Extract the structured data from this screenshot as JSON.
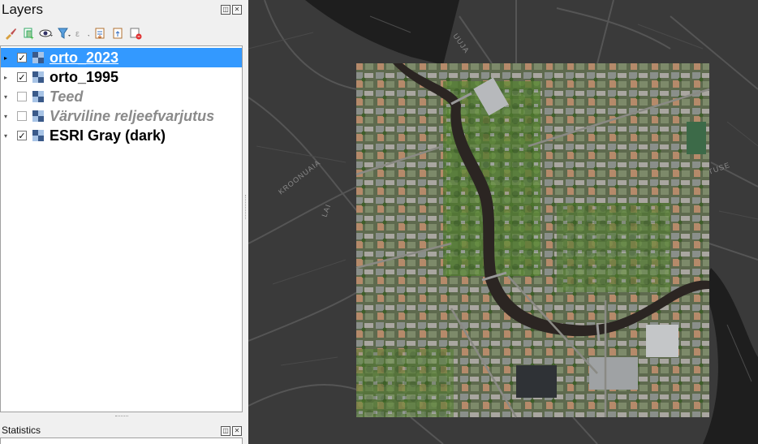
{
  "layers_panel": {
    "title": "Layers",
    "layers": [
      {
        "name": "orto_2023",
        "checked": true,
        "selected": true,
        "active": true,
        "expander": "▸"
      },
      {
        "name": "orto_1995",
        "checked": true,
        "selected": false,
        "active": true,
        "expander": "▸"
      },
      {
        "name": "Teed",
        "checked": false,
        "selected": false,
        "active": false,
        "expander": "▾"
      },
      {
        "name": "Värviline reljeefvarjutus",
        "checked": false,
        "selected": false,
        "active": false,
        "expander": "▾"
      },
      {
        "name": "ESRI Gray (dark)",
        "checked": true,
        "selected": false,
        "active": true,
        "expander": "▾"
      }
    ]
  },
  "statistics_panel": {
    "title": "Statistics"
  },
  "map": {
    "street_labels": [
      {
        "text": "KROONUAIA"
      },
      {
        "text": "UUJA"
      },
      {
        "text": "LAI"
      },
      {
        "text": "TUSE"
      }
    ],
    "colors": {
      "basemap": "#3a3a3a",
      "road": "#5a5a5a",
      "water": "#1e1e1e",
      "river_ortho": "#2b2522",
      "vegetation": "#4a6a2a"
    }
  }
}
